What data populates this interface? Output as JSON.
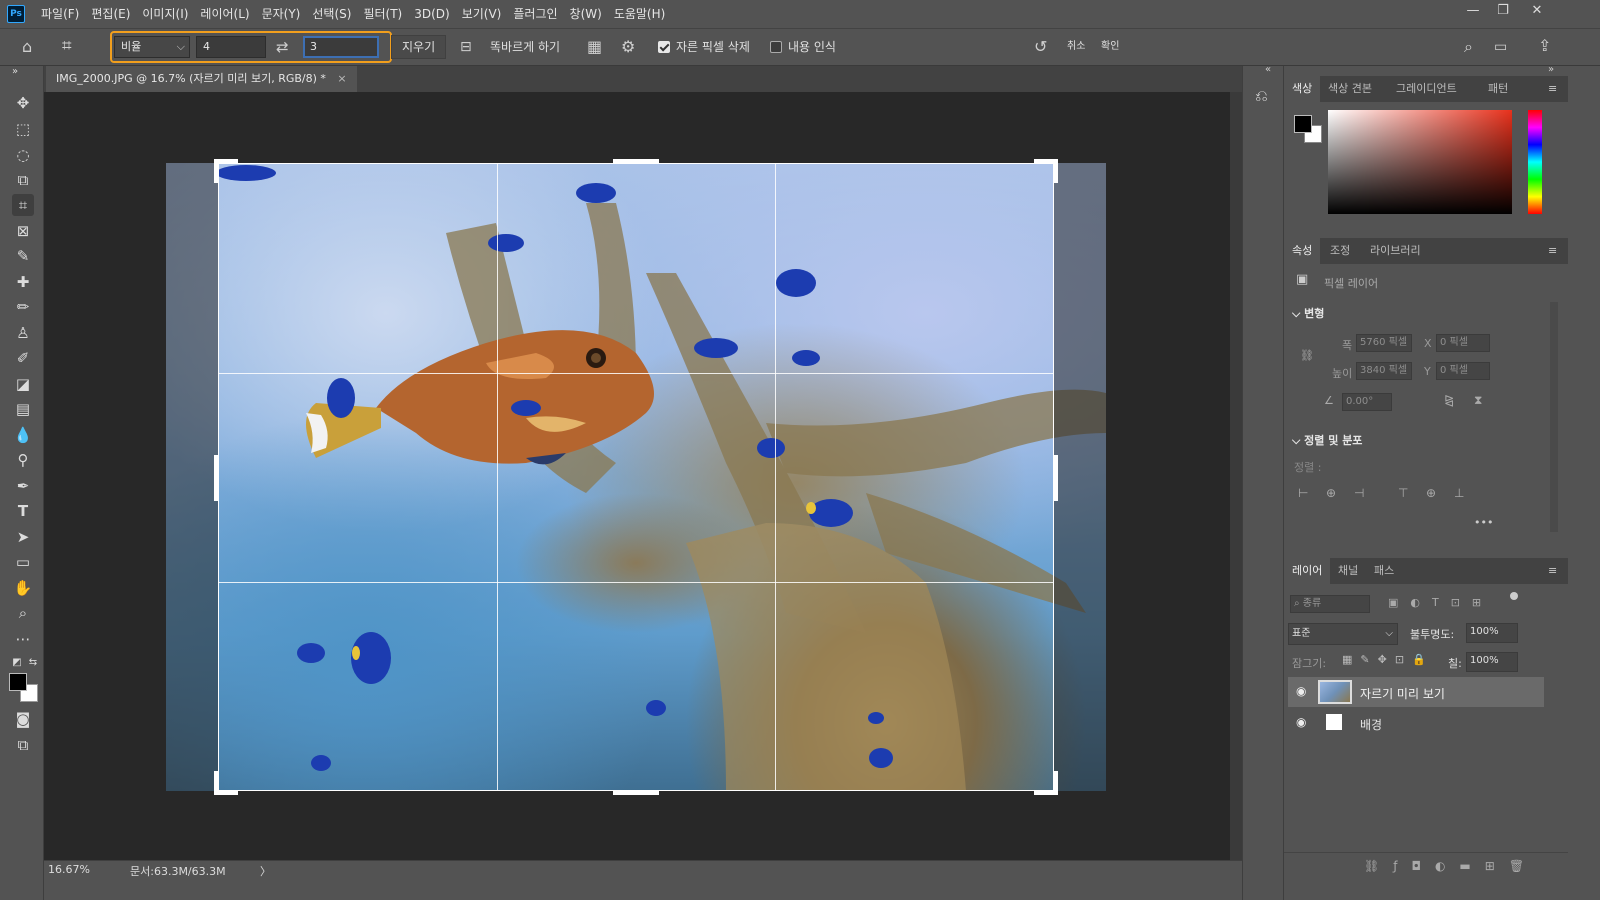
{
  "app": {
    "logo": "Ps"
  },
  "menu": [
    "파일(F)",
    "편집(E)",
    "이미지(I)",
    "레이어(L)",
    "문자(Y)",
    "선택(S)",
    "필터(T)",
    "3D(D)",
    "보기(V)",
    "플러그인",
    "창(W)",
    "도움말(H)"
  ],
  "window_controls": {
    "minimize": "—",
    "maximize": "❐",
    "close": "✕"
  },
  "options": {
    "ratio_preset": "비율",
    "width_value": "4",
    "height_value": "3",
    "clear_label": "지우기",
    "straighten_label": "똑바르게 하기",
    "delete_cropped_label": "자른 픽셀 삭제",
    "delete_cropped_checked": true,
    "content_aware_label": "내용 인식",
    "content_aware_checked": false,
    "cancel_label": "취소",
    "commit_label": "확인"
  },
  "document": {
    "tab_title": "IMG_2000.JPG @ 16.7% (자르기 미리 보기, RGB/8) *",
    "close": "×"
  },
  "status": {
    "zoom": "16.67%",
    "doc_size": "문서:63.3M/63.3M",
    "arrow": "〉"
  },
  "color_panel": {
    "tabs": [
      "색상",
      "색상 견본",
      "그레이디언트",
      "패턴"
    ],
    "active_tab": "색상",
    "hue_color": "#e8311c",
    "foreground": "#000000",
    "background": "#ffffff"
  },
  "properties_panel": {
    "tabs": [
      "속성",
      "조정",
      "라이브러리"
    ],
    "layer_kind": "픽셀 레이어",
    "transform_section": "변형",
    "width_label": "폭",
    "width_value": "5760 픽셀",
    "height_label": "높이",
    "height_value": "3840 픽셀",
    "x_label": "X",
    "x_value": "0 픽셀",
    "y_label": "Y",
    "y_value": "0 픽셀",
    "angle_value": "0.00°",
    "align_section": "정렬 및 분포",
    "align_label": "정렬 :",
    "more": "•••"
  },
  "layers_panel": {
    "tabs": [
      "레이어",
      "채널",
      "패스"
    ],
    "filter_placeholder": "종류",
    "blend_mode": "표준",
    "opacity_label": "불투명도:",
    "opacity_value": "100%",
    "lock_label": "잠그기:",
    "fill_label": "칠:",
    "fill_value": "100%",
    "layers": [
      {
        "name": "자르기 미리 보기",
        "visible": true,
        "selected": true
      },
      {
        "name": "배경",
        "visible": true,
        "selected": false
      }
    ]
  }
}
